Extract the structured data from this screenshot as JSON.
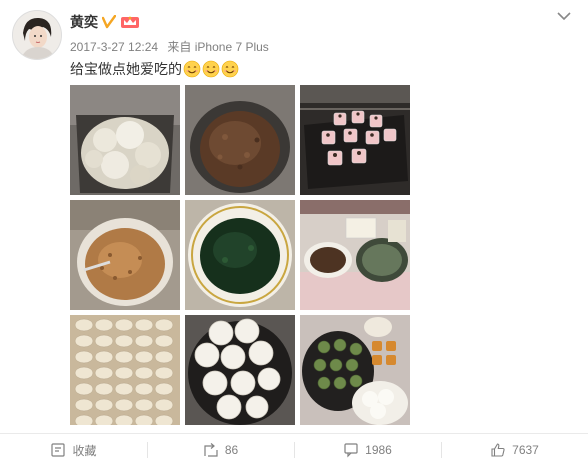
{
  "post": {
    "author": "黄奕",
    "time": "2017-3-27 12:24",
    "source": "来自 iPhone 7 Plus",
    "text": "给宝做点她爱吃的",
    "emoji_count": 3
  },
  "images": [
    {
      "caption": "steamed dough pieces in pot"
    },
    {
      "caption": "braised minced meat in pot"
    },
    {
      "caption": "cupcakes in oven"
    },
    {
      "caption": "pork floss in bowl"
    },
    {
      "caption": "green spinach puree"
    },
    {
      "caption": "ingredients on table"
    },
    {
      "caption": "rows of dumplings"
    },
    {
      "caption": "steamed buns on plate"
    },
    {
      "caption": "green dumplings and buns"
    }
  ],
  "actions": {
    "favorite_label": "收藏",
    "repost_count": "86",
    "comment_count": "1986",
    "like_count": "7637"
  },
  "colors": {
    "text": "#333333",
    "meta": "#808080",
    "accent": "#f5a623"
  }
}
